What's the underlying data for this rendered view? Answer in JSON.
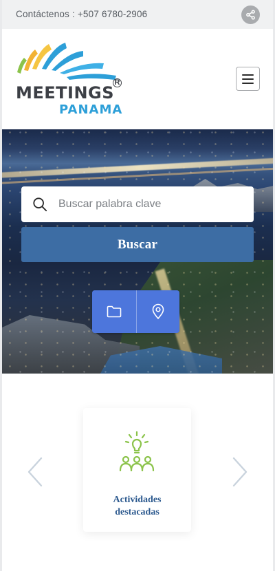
{
  "topbar": {
    "contact_text": "Contáctenos : +507 6780-2906",
    "share_icon": "share-icon"
  },
  "header": {
    "logo": {
      "word1": "MEETINGS",
      "registered": "R",
      "word2": "PANAMA"
    },
    "menu_icon": "hamburger-menu-icon"
  },
  "hero": {
    "search": {
      "placeholder": "Buscar palabra clave",
      "value": ""
    },
    "search_button": "Buscar",
    "quick_buttons": [
      {
        "icon": "folder-icon"
      },
      {
        "icon": "map-pin-icon"
      }
    ]
  },
  "carousel": {
    "items": [
      {
        "title": "Actividades destacadas",
        "icon": "group-idea-icon"
      }
    ],
    "prev_icon": "chevron-left-icon",
    "next_icon": "chevron-right-icon"
  },
  "colors": {
    "brand_blue": "#3d6da4",
    "accent_blue": "#4d76dc",
    "card_title": "#2d5a8f",
    "icon_green": "#8bc34a",
    "logo_blue": "#2d9fd8",
    "topbar_bg": "#f0f1f2"
  }
}
